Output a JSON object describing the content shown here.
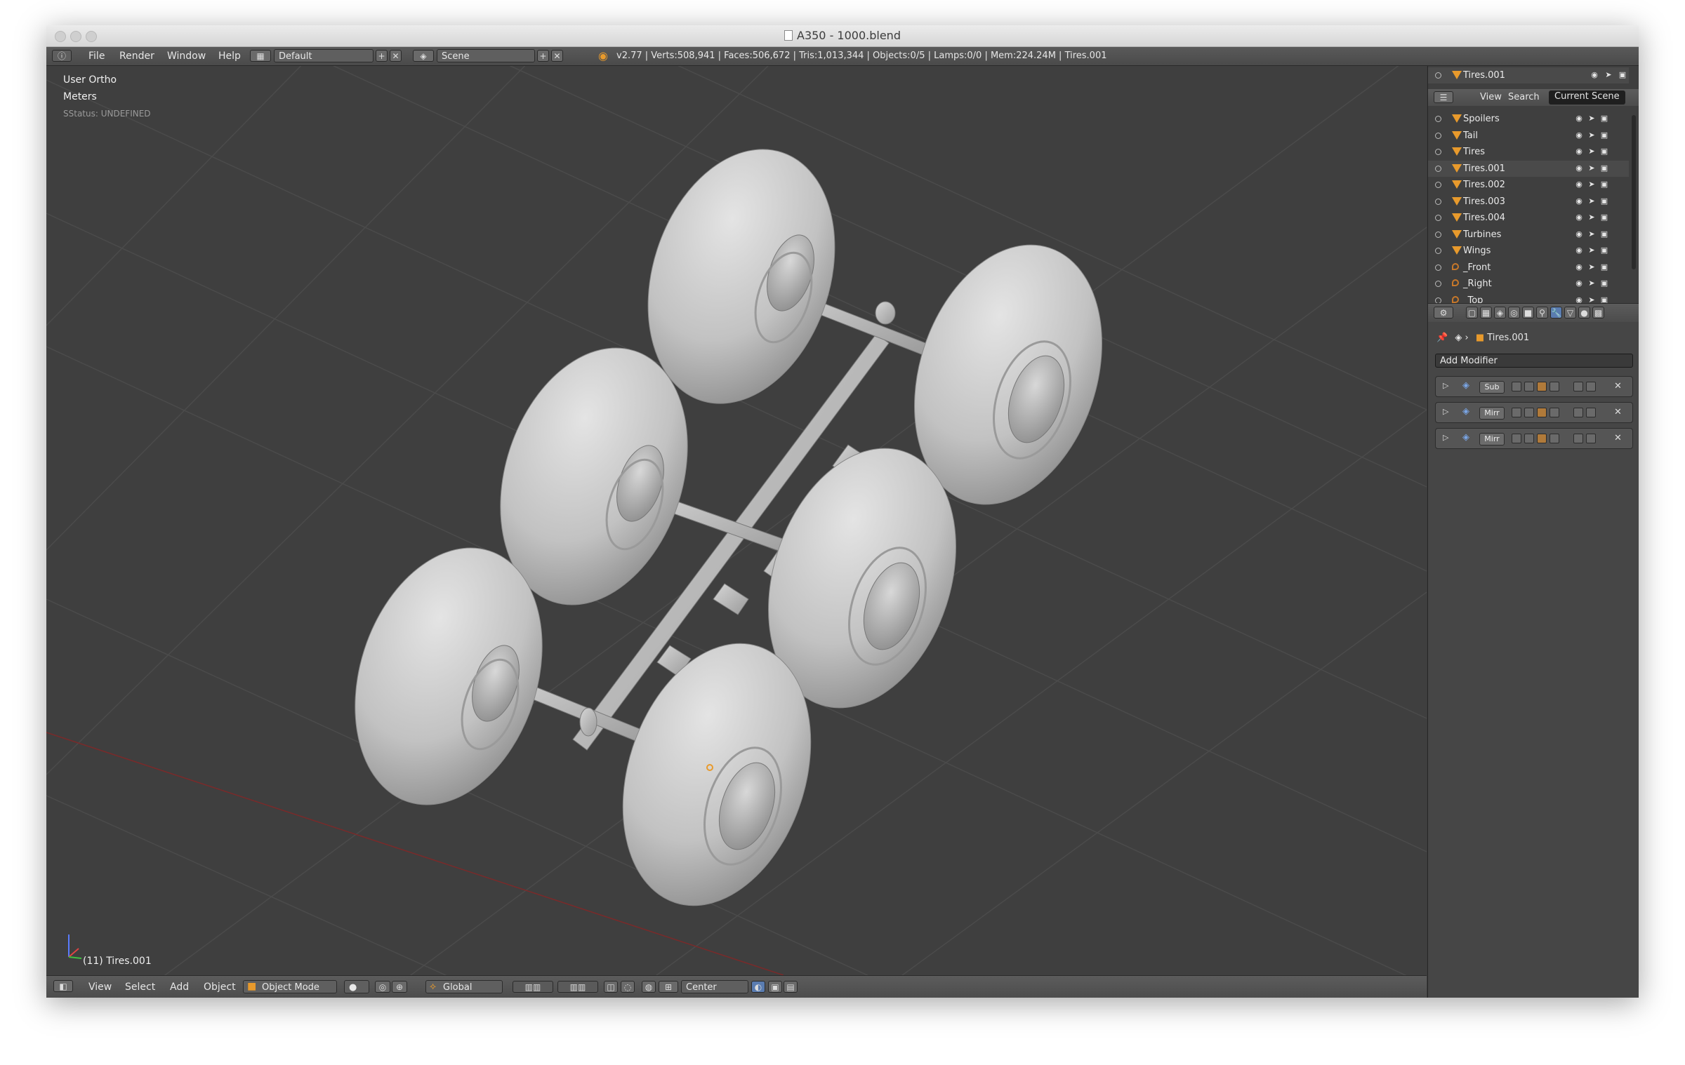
{
  "window": {
    "title": "A350 - 1000.blend"
  },
  "menu": {
    "items": [
      "File",
      "Render",
      "Window",
      "Help"
    ]
  },
  "screen_layout": "Default",
  "scene": "Scene",
  "stats": "v2.77 | Verts:508,941 | Faces:506,672 | Tris:1,013,344 | Objects:0/5 | Lamps:0/0 | Mem:224.24M | Tires.001",
  "viewport": {
    "view_name": "User Ortho",
    "units": "Meters",
    "status": "SStatus: UNDEFINED",
    "active_object": "(11) Tires.001"
  },
  "header3d": {
    "menus": [
      "View",
      "Select",
      "Add",
      "Object"
    ],
    "mode": "Object Mode",
    "orientation": "Global",
    "pivot": "Center"
  },
  "outliner": {
    "active_item": "Tires.001",
    "tabs": [
      "View",
      "Search",
      "Current Scene"
    ],
    "items": [
      {
        "name": "Spoilers",
        "kind": "mesh"
      },
      {
        "name": "Tail",
        "kind": "mesh"
      },
      {
        "name": "Tires",
        "kind": "mesh"
      },
      {
        "name": "Tires.001",
        "kind": "mesh"
      },
      {
        "name": "Tires.002",
        "kind": "mesh"
      },
      {
        "name": "Tires.003",
        "kind": "mesh"
      },
      {
        "name": "Tires.004",
        "kind": "mesh"
      },
      {
        "name": "Turbines",
        "kind": "mesh"
      },
      {
        "name": "Wings",
        "kind": "mesh"
      },
      {
        "name": "_Front",
        "kind": "camera"
      },
      {
        "name": "_Right",
        "kind": "camera"
      },
      {
        "name": "_Top",
        "kind": "camera"
      }
    ]
  },
  "properties": {
    "breadcrumb_object": "Tires.001",
    "add_modifier": "Add Modifier",
    "modifiers": [
      {
        "label": "Sub"
      },
      {
        "label": "Mirr"
      },
      {
        "label": "Mirr"
      }
    ]
  },
  "colors": {
    "accent": "#e89a2c",
    "highlight_tab": "#1f1f1f",
    "viewport_bg": "#3f3f3f",
    "selected_row": "#596a82"
  }
}
